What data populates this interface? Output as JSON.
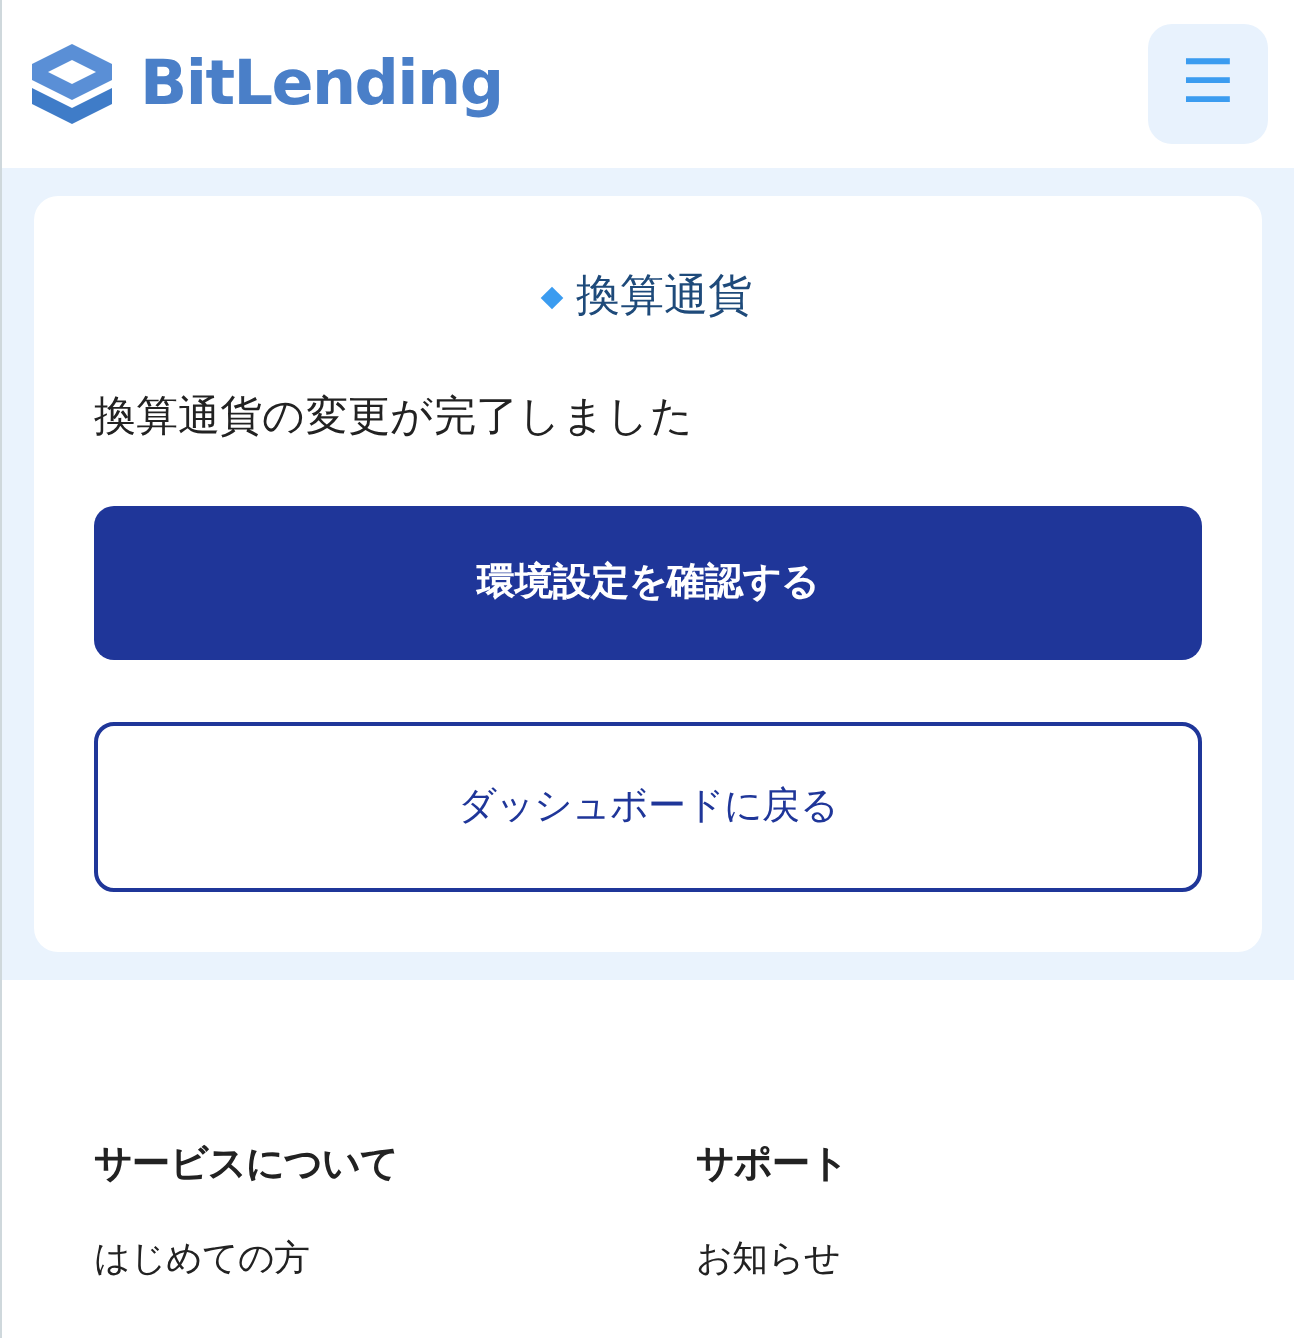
{
  "header": {
    "logo_text": "BitLending",
    "menu_icon": "☰"
  },
  "card": {
    "title": "換算通貨",
    "message": "換算通貨の変更が完了しました",
    "buttons": [
      {
        "label": "環境設定を確認する",
        "kind": "primary"
      },
      {
        "label": "ダッシュボードに戻る",
        "kind": "outline"
      }
    ]
  },
  "footer": {
    "columns": [
      {
        "heading": "サービスについて",
        "links": [
          "はじめての方"
        ]
      },
      {
        "heading": "サポート",
        "links": [
          "お知らせ"
        ]
      }
    ]
  }
}
